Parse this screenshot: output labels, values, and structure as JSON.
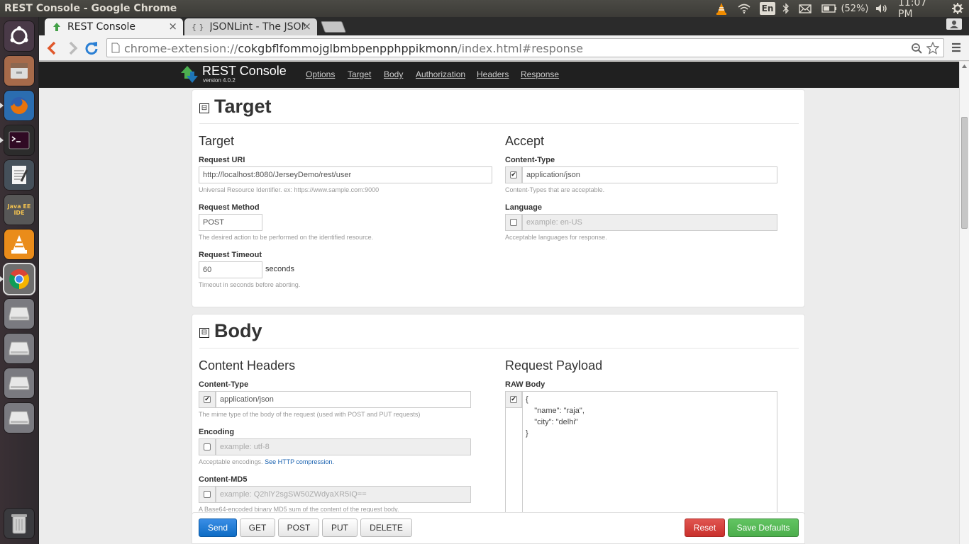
{
  "os": {
    "window_title": "REST Console - Google Chrome",
    "battery": "(52%)",
    "clock": "11:07 PM",
    "keyboard": "En"
  },
  "launcher": [
    "dash-home",
    "files",
    "firefox",
    "terminal",
    "text-editor",
    "java-ee-ide",
    "vlc",
    "chrome",
    "drive-1",
    "drive-2",
    "drive-3",
    "drive-4",
    "trash"
  ],
  "launcher_java_label": "Java EE IDE",
  "browser": {
    "tabs": [
      {
        "title": "REST Console",
        "close": "×"
      },
      {
        "title": "JSONLint - The JSON",
        "icon": "{ }",
        "close": "×"
      }
    ],
    "url_prefix": "chrome-extension://",
    "url_host": "cokgbflfommojglbmbpenpphppikmonn",
    "url_path": "/index.html#response"
  },
  "app": {
    "title": "REST Console",
    "version": "version 4.0.2",
    "nav": [
      "Options",
      "Target",
      "Body",
      "Authorization",
      "Headers",
      "Response"
    ]
  },
  "target": {
    "section_title": "Target",
    "left_heading": "Target",
    "right_heading": "Accept",
    "request_uri": {
      "label": "Request URI",
      "value": "http://localhost:8080/JerseyDemo/rest/user",
      "help": "Universal Resource Identifier. ex: https://www.sample.com:9000"
    },
    "request_method": {
      "label": "Request Method",
      "value": "POST",
      "help": "The desired action to be performed on the identified resource."
    },
    "request_timeout": {
      "label": "Request Timeout",
      "value": "60",
      "unit": "seconds",
      "help": "Timeout in seconds before aborting."
    },
    "accept_content_type": {
      "label": "Content-Type",
      "value": "application/json",
      "checked": true,
      "help": "Content-Types that are acceptable."
    },
    "language": {
      "label": "Language",
      "placeholder": "example: en-US",
      "checked": false,
      "help": "Acceptable languages for response."
    }
  },
  "body": {
    "section_title": "Body",
    "left_heading": "Content Headers",
    "right_heading": "Request Payload",
    "content_type": {
      "label": "Content-Type",
      "value": "application/json",
      "checked": true,
      "help": "The mime type of the body of the request (used with POST and PUT requests)"
    },
    "encoding": {
      "label": "Encoding",
      "placeholder": "example: utf-8",
      "checked": false,
      "help": "Acceptable encodings.",
      "help_link": "See HTTP compression."
    },
    "content_md5": {
      "label": "Content-MD5",
      "placeholder": "example: Q2hlY2sgSW50ZWdyaXR5IQ==",
      "checked": false,
      "help": "A Base64-encoded binary MD5 sum of the content of the request body."
    },
    "raw_body": {
      "label": "RAW Body",
      "checked": true,
      "lines": [
        "{",
        "    \"name\": \"raja\",",
        "    \"city\": \"delhi\"",
        "}"
      ]
    }
  },
  "actions": {
    "send": "Send",
    "get": "GET",
    "post": "POST",
    "put": "PUT",
    "delete": "DELETE",
    "reset": "Reset",
    "save_defaults": "Save Defaults"
  },
  "colors": {
    "primary": "#0e6cc4",
    "danger": "#c9302c",
    "success": "#4cae4c",
    "navbar": "#202020",
    "launcher": "#322b30"
  }
}
